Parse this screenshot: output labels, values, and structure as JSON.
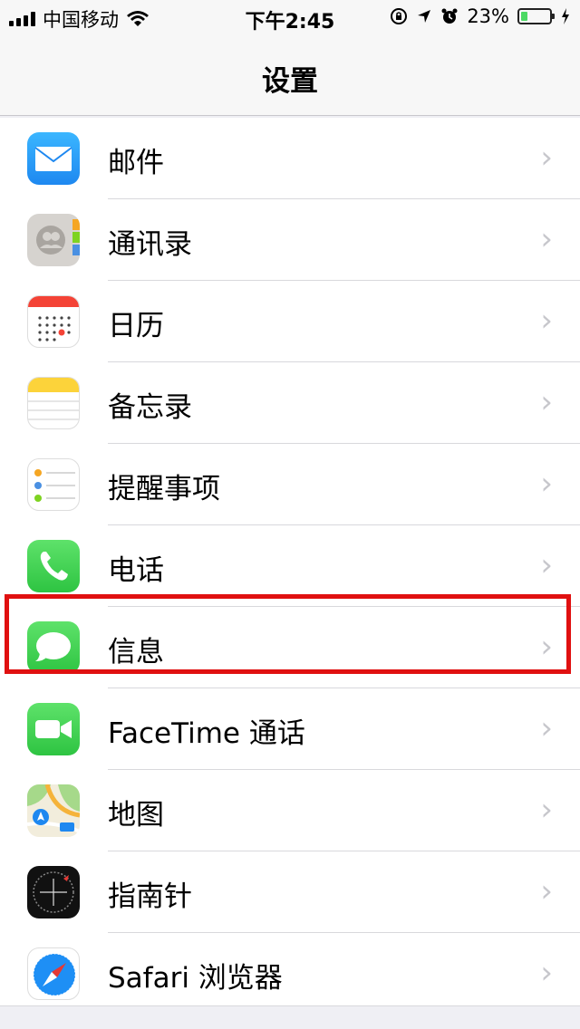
{
  "status_bar": {
    "carrier": "中国移动",
    "time": "下午2:45",
    "battery_percent": "23%",
    "battery_level": 0.23,
    "icons": [
      "signal-icon",
      "wifi-icon",
      "rotation-lock-icon",
      "location-icon",
      "alarm-icon",
      "battery-icon",
      "charging-icon"
    ]
  },
  "nav": {
    "title": "设置"
  },
  "settings_list": [
    {
      "label": "邮件",
      "icon": "mail-icon"
    },
    {
      "label": "通讯录",
      "icon": "contacts-icon"
    },
    {
      "label": "日历",
      "icon": "calendar-icon"
    },
    {
      "label": "备忘录",
      "icon": "notes-icon"
    },
    {
      "label": "提醒事项",
      "icon": "reminders-icon"
    },
    {
      "label": "电话",
      "icon": "phone-icon"
    },
    {
      "label": "信息",
      "icon": "messages-icon",
      "highlighted": true
    },
    {
      "label": "FaceTime 通话",
      "icon": "facetime-icon"
    },
    {
      "label": "地图",
      "icon": "maps-icon"
    },
    {
      "label": "指南针",
      "icon": "compass-icon"
    },
    {
      "label": "Safari 浏览器",
      "icon": "safari-icon"
    }
  ],
  "colors": {
    "highlight": "#e01010",
    "chevron": "#c7c7cc",
    "battery_fill": "#4cd964"
  },
  "chevron_glyph": "›"
}
